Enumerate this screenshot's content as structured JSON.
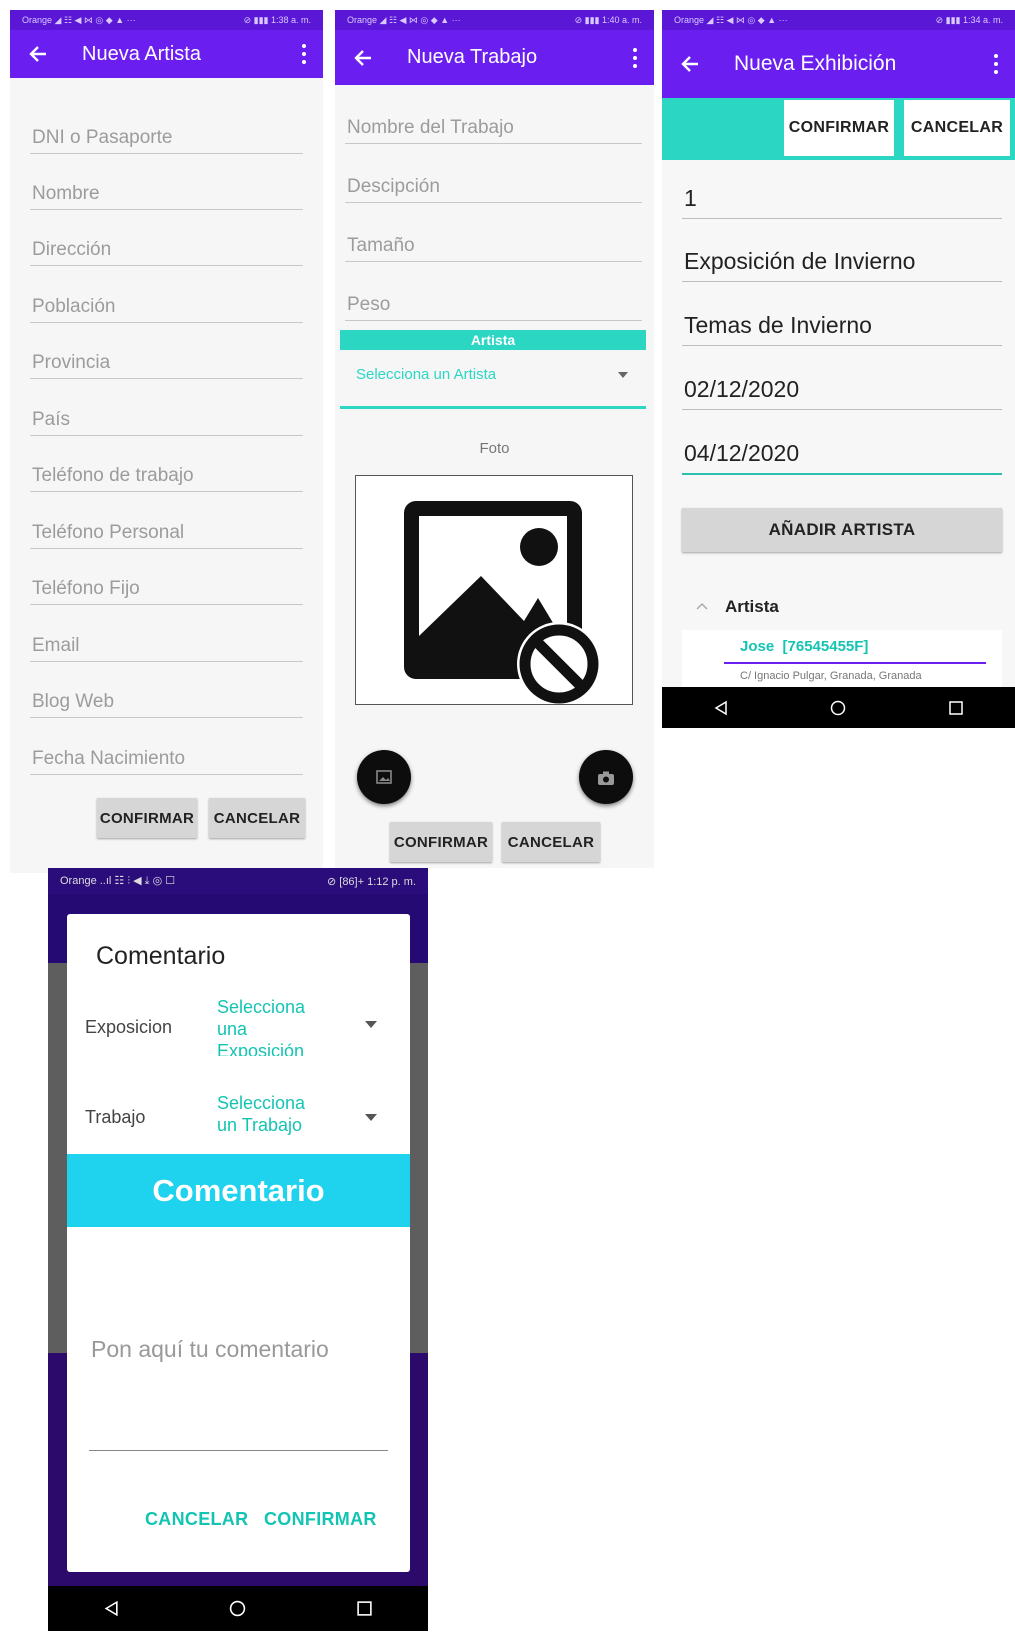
{
  "screens": {
    "artista": {
      "status_left": "Orange ◢ ☷ ◀ ⋈ ◎ ◆ ▲ ···",
      "status_right": "⊘ ▮▮▮ 1:38 a. m.",
      "title": "Nueva Artista",
      "fields": [
        "DNI o Pasaporte",
        "Nombre",
        "Dirección",
        "Población",
        "Provincia",
        "País",
        "Teléfono de trabajo",
        "Teléfono Personal",
        "Teléfono Fijo",
        "Email",
        "Blog Web",
        "Fecha Nacimiento"
      ],
      "confirm_label": "CONFIRMAR",
      "cancel_label": "CANCELAR"
    },
    "trabajo": {
      "status_left": "Orange ◢ ☷ ◀ ⋈ ◎ ◆ ▲ ···",
      "status_right": "⊘ ▮▮▮ 1:40 a. m.",
      "title": "Nueva Trabajo",
      "fields": [
        "Nombre del Trabajo",
        "Descipción",
        "Tamaño",
        "Peso"
      ],
      "artista_header": "Artista",
      "artista_select": "Selecciona un Artista",
      "foto_label": "Foto",
      "confirm_label": "CONFIRMAR",
      "cancel_label": "CANCELAR"
    },
    "exhibicion": {
      "status_left": "Orange ◢ ☷ ◀ ⋈ ◎ ◆ ▲ ···",
      "status_right": "⊘ ▮▮▮ 1:34 a. m.",
      "title": "Nueva Exhibición",
      "confirm_label": "CONFIRMAR",
      "cancel_label": "CANCELAR",
      "values": [
        "1",
        "Exposición de Invierno",
        "Temas de Invierno",
        "02/12/2020",
        "04/12/2020"
      ],
      "add_artist_label": "AÑADIR ARTISTA",
      "artista_section": "Artista",
      "artist_item": "Jose  [76545455F]",
      "artist_subtext": "C/ Ignacio Pulgar, Granada, Granada"
    },
    "comentario": {
      "status_left": "Orange ..ıl ☷ ⫶ ◀ ⤓ ◎ ☐",
      "status_right": "⊘ [86]+ 1:12 p. m.",
      "dialog_title": "Comentario",
      "exposicion_label": "Exposicion",
      "exposicion_select": "Selecciona una Exposición",
      "trabajo_label": "Trabajo",
      "trabajo_select": "Selecciona un Trabajo",
      "banner": "Comentario",
      "comment_placeholder": "Pon aquí tu comentario",
      "cancel_label": "CANCELAR",
      "confirm_label": "CONFIRMAR"
    }
  },
  "colors": {
    "appbar": "#6a1ff0",
    "statusbar": "#5a17d6",
    "teal": "#2bd6c3",
    "cyan": "#1fd2ee",
    "teal_text": "#14c4b3",
    "dark_purple": "#2b0a6b"
  }
}
